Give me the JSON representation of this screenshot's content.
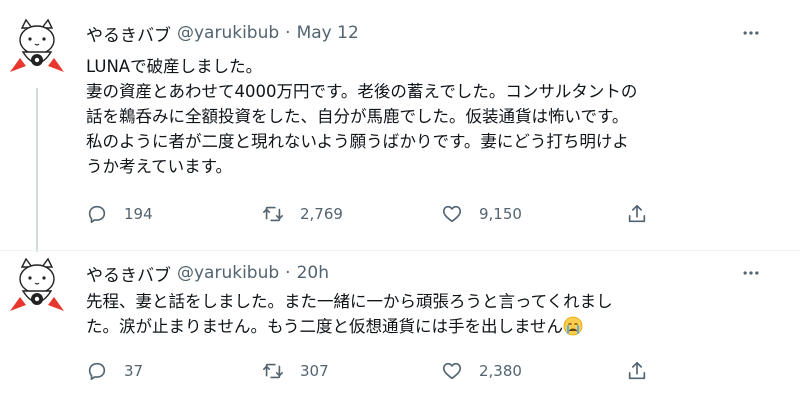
{
  "tweets": [
    {
      "display_name": "やるきバブ",
      "handle": "@yarukibub",
      "separator": "·",
      "time": "May 12",
      "lines": [
        "LUNAで破産しました。",
        "妻の資産とあわせて4000万円です。老後の蓄えでした。コンサルタントの",
        "話を鵜呑みに全額投資をした、自分が馬鹿でした。仮装通貨は怖いです。",
        "私のように者が二度と現れないよう願うばかりです。妻にどう打ち明けよ",
        "うか考えています。"
      ],
      "replies": "194",
      "retweets": "2,769",
      "likes": "9,150"
    },
    {
      "display_name": "やるきバブ",
      "handle": "@yarukibub",
      "separator": "·",
      "time": "20h",
      "lines": [
        "先程、妻と話をしました。また一緒に一から頑張ろうと言ってくれまし",
        "た。涙が止まりません。もう二度と仮想通貨には手を出しません"
      ],
      "emoji": "crying-face",
      "replies": "37",
      "retweets": "307",
      "likes": "2,380"
    }
  ],
  "colors": {
    "text": "#0f1419",
    "secondary": "#536471",
    "thread_line": "#cfd9de",
    "avatar_cape": "#e8372e"
  },
  "icons": [
    "cat-avatar-icon",
    "more-options-icon",
    "reply-icon",
    "retweet-icon",
    "like-icon",
    "share-icon",
    "crying-face-emoji"
  ]
}
